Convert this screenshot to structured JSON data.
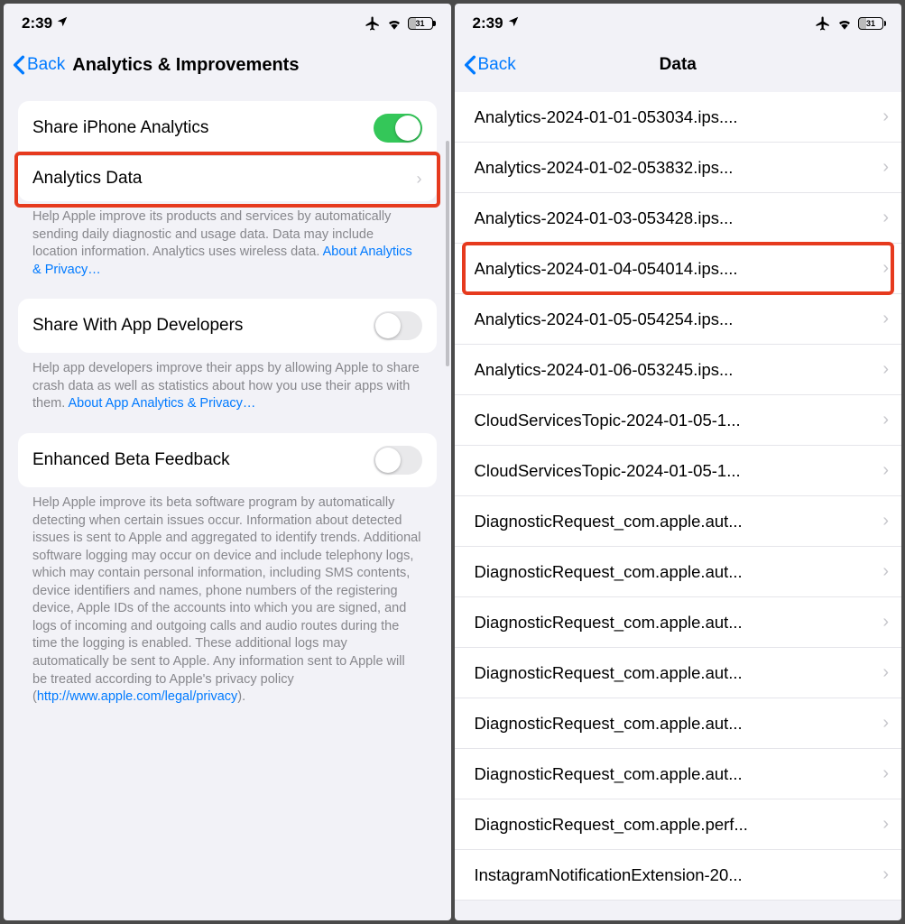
{
  "status": {
    "time": "2:39",
    "battery": "31"
  },
  "left": {
    "back": "Back",
    "title": "Analytics & Improvements",
    "share_iphone": "Share iPhone Analytics",
    "analytics_data": "Analytics Data",
    "footer1_a": "Help Apple improve its products and services by automatically sending daily diagnostic and usage data. Data may include location information. Analytics uses wireless data. ",
    "footer1_link": "About Analytics & Privacy…",
    "share_dev": "Share With App Developers",
    "footer2_a": "Help app developers improve their apps by allowing Apple to share crash data as well as statistics about how you use their apps with them. ",
    "footer2_link": "About App Analytics & Privacy…",
    "beta": "Enhanced Beta Feedback",
    "footer3_a": "Help Apple improve its beta software program by automatically detecting when certain issues occur. Information about detected issues is sent to Apple and aggregated to identify trends. Additional software logging may occur on device and include telephony logs, which may contain personal information, including SMS contents, device identifiers and names, phone numbers of the registering device, Apple IDs of the accounts into which you are signed, and logs of incoming and outgoing calls and audio routes during the time the logging is enabled. These additional logs may automatically be sent to Apple. Any information sent to Apple will be treated according to Apple's privacy policy (",
    "footer3_link": "http://www.apple.com/legal/privacy",
    "footer3_b": ")."
  },
  "right": {
    "back": "Back",
    "title": "Data",
    "items": [
      "Analytics-2024-01-01-053034.ips....",
      "Analytics-2024-01-02-053832.ips...",
      "Analytics-2024-01-03-053428.ips...",
      "Analytics-2024-01-04-054014.ips....",
      "Analytics-2024-01-05-054254.ips...",
      "Analytics-2024-01-06-053245.ips...",
      "CloudServicesTopic-2024-01-05-1...",
      "CloudServicesTopic-2024-01-05-1...",
      "DiagnosticRequest_com.apple.aut...",
      "DiagnosticRequest_com.apple.aut...",
      "DiagnosticRequest_com.apple.aut...",
      "DiagnosticRequest_com.apple.aut...",
      "DiagnosticRequest_com.apple.aut...",
      "DiagnosticRequest_com.apple.aut...",
      "DiagnosticRequest_com.apple.perf...",
      "InstagramNotificationExtension-20..."
    ],
    "highlight_index": 3
  }
}
